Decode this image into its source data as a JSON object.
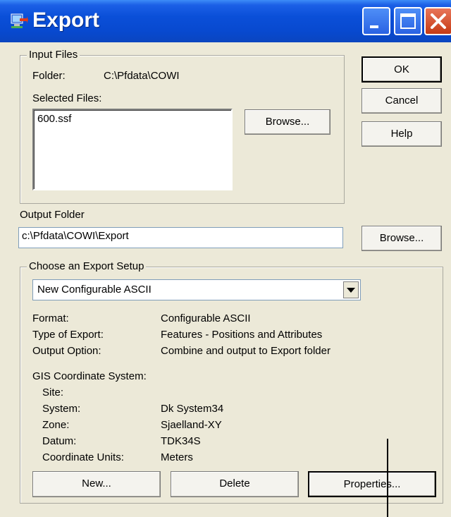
{
  "window": {
    "title": "Export"
  },
  "input_files": {
    "legend": "Input Files",
    "folder_label": "Folder:",
    "folder_value": "C:\\Pfdata\\COWI",
    "selected_label": "Selected Files:",
    "files": [
      "600.ssf"
    ],
    "browse_label": "Browse..."
  },
  "buttons": {
    "ok": "OK",
    "cancel": "Cancel",
    "help": "Help"
  },
  "output_folder": {
    "label": "Output Folder",
    "value": "c:\\Pfdata\\COWI\\Export",
    "browse_label": "Browse..."
  },
  "export_setup": {
    "legend": "Choose an Export Setup",
    "selected": "New Configurable ASCII",
    "format_label": "Format:",
    "format_value": "Configurable ASCII",
    "type_label": "Type of Export:",
    "type_value": "Features - Positions and Attributes",
    "output_label": "Output Option:",
    "output_value": "Combine and output to Export folder",
    "gis_label": "GIS Coordinate System:",
    "site_label": "Site:",
    "site_value": "",
    "system_label": "System:",
    "system_value": "Dk System34",
    "zone_label": "Zone:",
    "zone_value": "Sjaelland-XY",
    "datum_label": "Datum:",
    "datum_value": "TDK34S",
    "units_label": "Coordinate Units:",
    "units_value": "Meters",
    "new_label": "New...",
    "delete_label": "Delete",
    "properties_label": "Properties..."
  }
}
